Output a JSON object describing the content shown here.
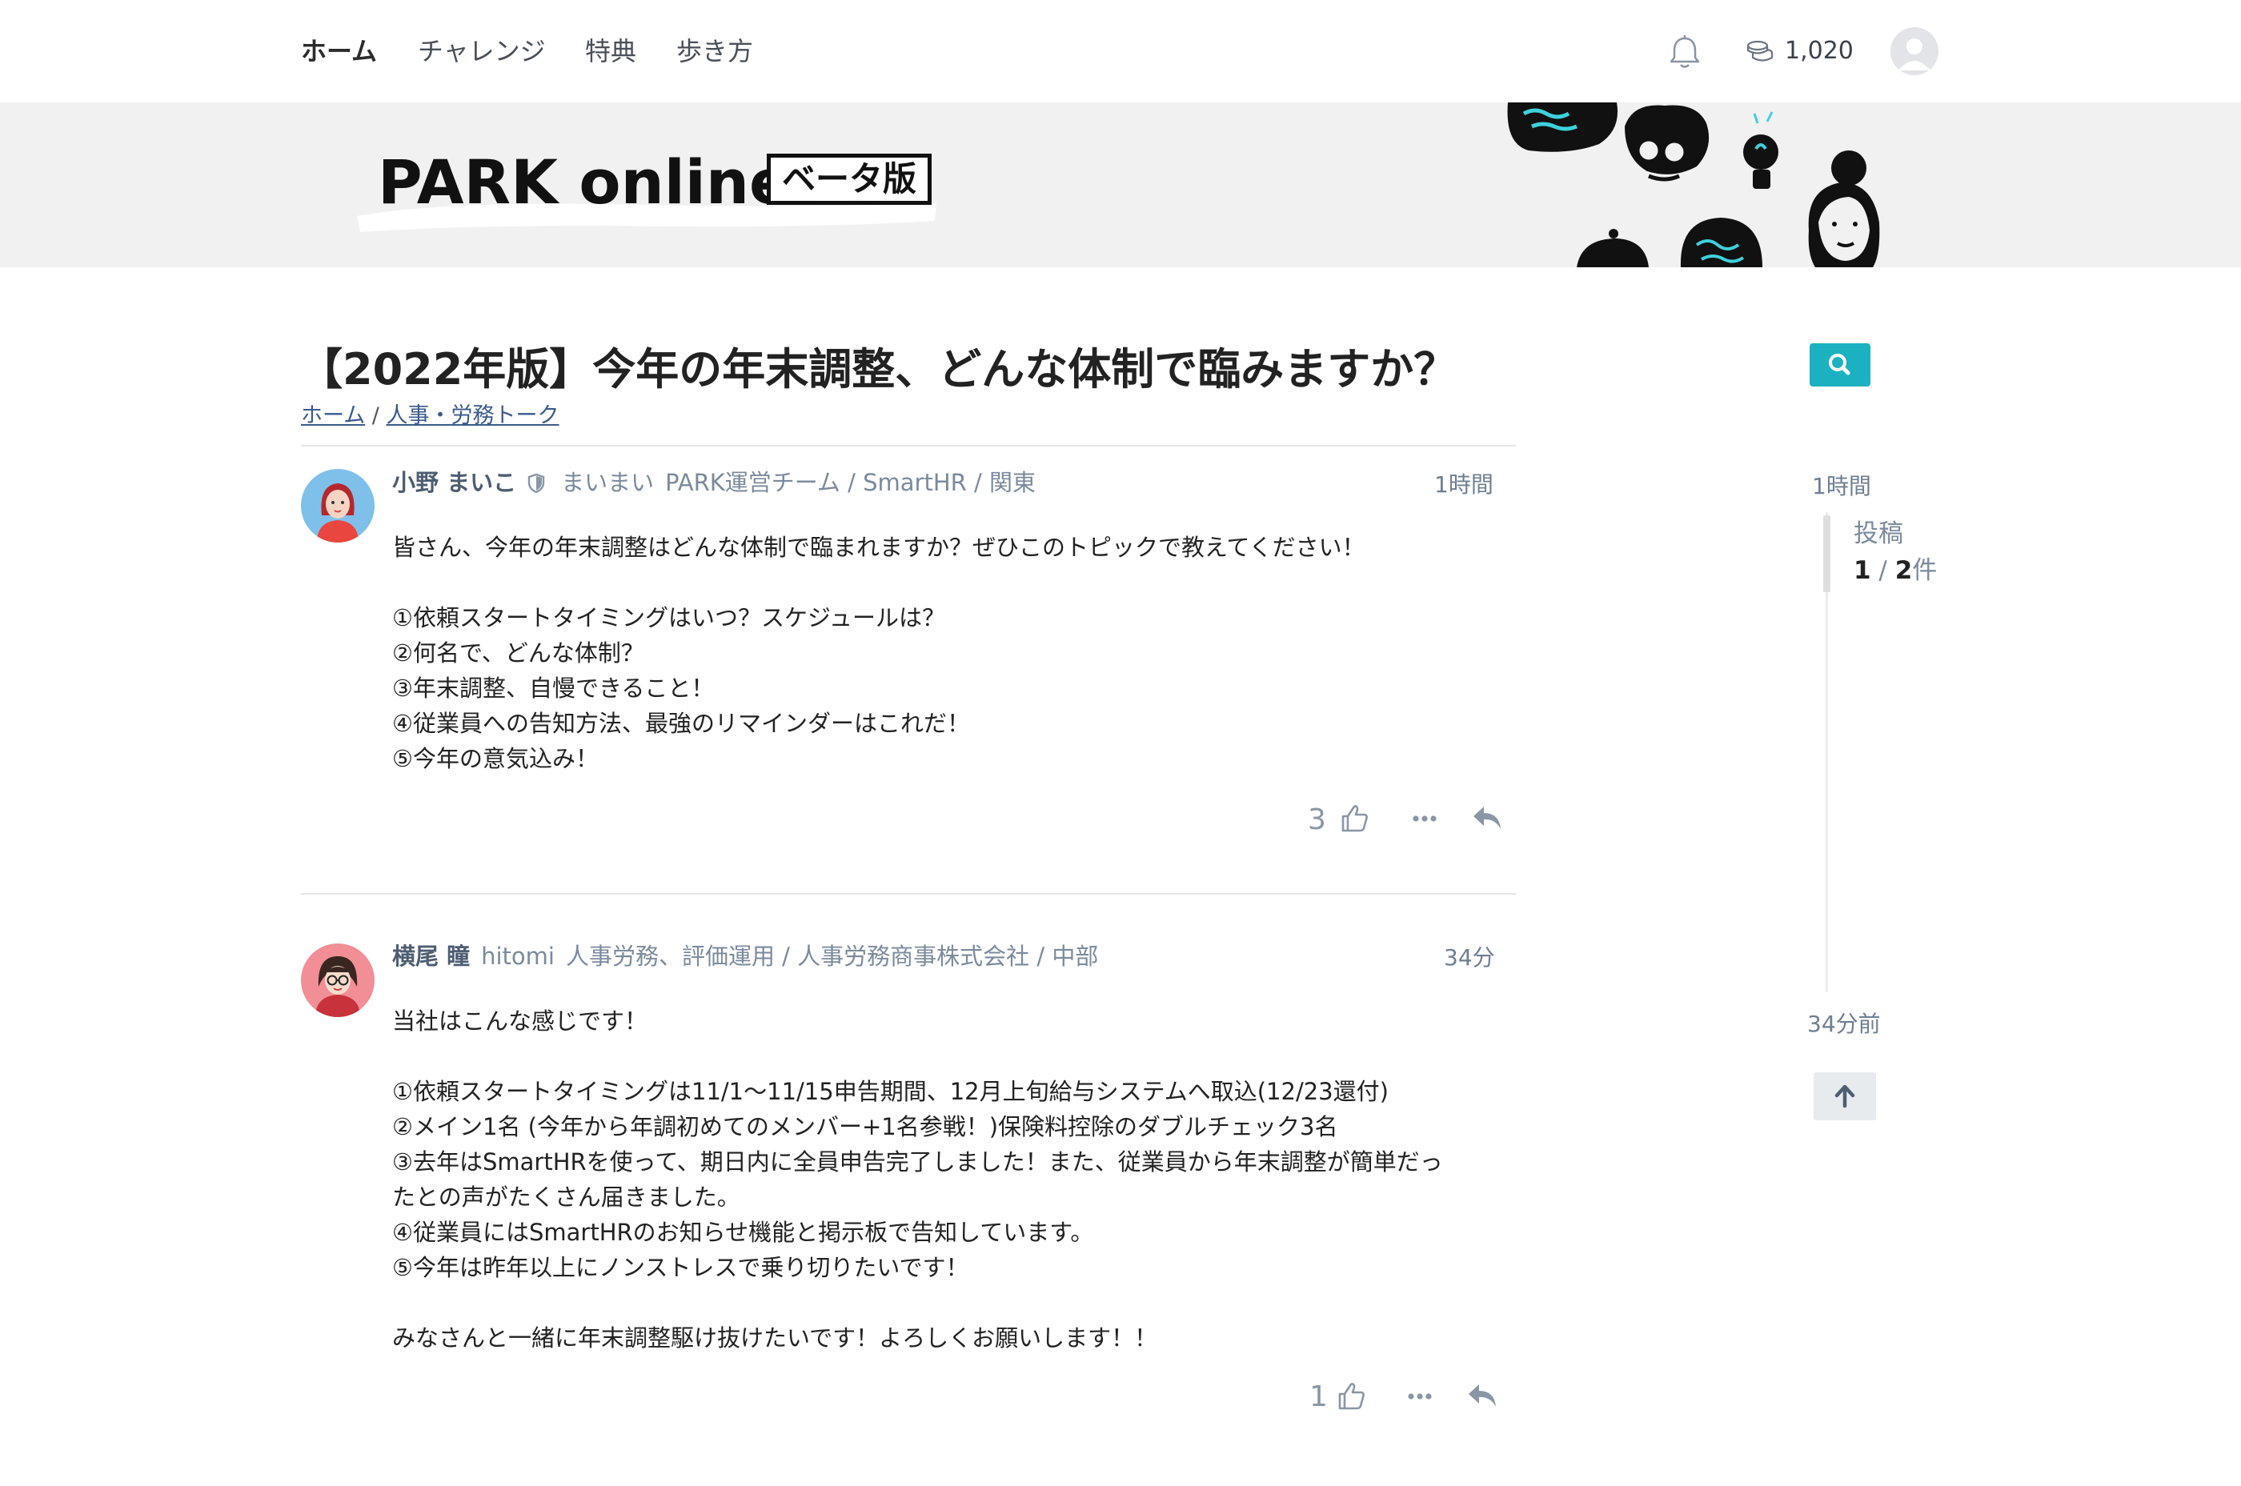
{
  "nav": {
    "items": [
      "ホーム",
      "チャレンジ",
      "特典",
      "歩き方"
    ],
    "coins": "1,020"
  },
  "banner": {
    "logo": "PARK online",
    "beta": "ベータ版"
  },
  "topic": {
    "title": "【2022年版】今年の年末調整、どんな体制で臨みますか？",
    "breadcrumb": {
      "home": "ホーム",
      "sep": " / ",
      "category": "人事・労務トーク"
    }
  },
  "posts": [
    {
      "user_name": "小野 まいこ",
      "handle": "まいまい",
      "affiliation": "PARK運営チーム / SmartHR / 関東",
      "time": "1時間",
      "body": [
        "皆さん、今年の年末調整はどんな体制で臨まれますか？ぜひこのトピックで教えてください！",
        "",
        "①依頼スタートタイミングはいつ？スケジュールは？",
        "②何名で、どんな体制？",
        "③年末調整、自慢できること！",
        "④従業員への告知方法、最強のリマインダーはこれだ！",
        "⑤今年の意気込み！"
      ],
      "likes": "3"
    },
    {
      "user_name": "横尾 瞳",
      "handle": "hitomi",
      "affiliation": "人事労務、評価運用 / 人事労務商事株式会社 / 中部",
      "time": "34分",
      "body": [
        "当社はこんな感じです！",
        "",
        "①依頼スタートタイミングは11/1〜11/15申告期間、12月上旬給与システムへ取込(12/23還付)",
        "②メイン1名 (今年から年調初めてのメンバー+1名参戦！)保険料控除のダブルチェック3名",
        "③去年はSmartHRを使って、期日内に全員申告完了しました！また、従業員から年末調整が簡単だっ",
        "たとの声がたくさん届きました。",
        "④従業員にはSmartHRのお知らせ機能と掲示板で告知しています。",
        "⑤今年は昨年以上にノンストレスで乗り切りたいです！",
        "",
        "みなさんと一緒に年末調整駆け抜けたいです！よろしくお願いします！！"
      ],
      "likes": "1"
    }
  ],
  "timeline": {
    "top_time": "1時間",
    "label": "投稿",
    "current": "1",
    "sep": " / ",
    "total": "2",
    "unit": "件",
    "bottom_time": "34分前"
  },
  "colors": {
    "accent": "#1bb1c1",
    "text_meta": "#7b8a9d",
    "banner_bg": "#f1f1f1"
  },
  "icons": [
    "bell-icon",
    "coin-icon",
    "user-avatar-icon",
    "search-icon",
    "moderator-shield-icon",
    "thumbs-up-icon",
    "more-icon",
    "reply-icon",
    "arrow-up-icon"
  ]
}
